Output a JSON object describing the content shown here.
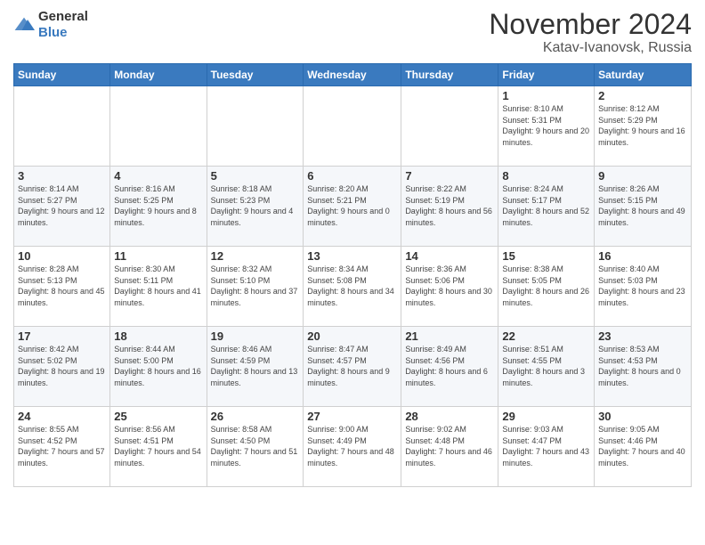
{
  "header": {
    "logo_general": "General",
    "logo_blue": "Blue",
    "month_title": "November 2024",
    "location": "Katav-Ivanovsk, Russia"
  },
  "weekdays": [
    "Sunday",
    "Monday",
    "Tuesday",
    "Wednesday",
    "Thursday",
    "Friday",
    "Saturday"
  ],
  "weeks": [
    [
      {
        "day": "",
        "info": ""
      },
      {
        "day": "",
        "info": ""
      },
      {
        "day": "",
        "info": ""
      },
      {
        "day": "",
        "info": ""
      },
      {
        "day": "",
        "info": ""
      },
      {
        "day": "1",
        "info": "Sunrise: 8:10 AM\nSunset: 5:31 PM\nDaylight: 9 hours and 20 minutes."
      },
      {
        "day": "2",
        "info": "Sunrise: 8:12 AM\nSunset: 5:29 PM\nDaylight: 9 hours and 16 minutes."
      }
    ],
    [
      {
        "day": "3",
        "info": "Sunrise: 8:14 AM\nSunset: 5:27 PM\nDaylight: 9 hours and 12 minutes."
      },
      {
        "day": "4",
        "info": "Sunrise: 8:16 AM\nSunset: 5:25 PM\nDaylight: 9 hours and 8 minutes."
      },
      {
        "day": "5",
        "info": "Sunrise: 8:18 AM\nSunset: 5:23 PM\nDaylight: 9 hours and 4 minutes."
      },
      {
        "day": "6",
        "info": "Sunrise: 8:20 AM\nSunset: 5:21 PM\nDaylight: 9 hours and 0 minutes."
      },
      {
        "day": "7",
        "info": "Sunrise: 8:22 AM\nSunset: 5:19 PM\nDaylight: 8 hours and 56 minutes."
      },
      {
        "day": "8",
        "info": "Sunrise: 8:24 AM\nSunset: 5:17 PM\nDaylight: 8 hours and 52 minutes."
      },
      {
        "day": "9",
        "info": "Sunrise: 8:26 AM\nSunset: 5:15 PM\nDaylight: 8 hours and 49 minutes."
      }
    ],
    [
      {
        "day": "10",
        "info": "Sunrise: 8:28 AM\nSunset: 5:13 PM\nDaylight: 8 hours and 45 minutes."
      },
      {
        "day": "11",
        "info": "Sunrise: 8:30 AM\nSunset: 5:11 PM\nDaylight: 8 hours and 41 minutes."
      },
      {
        "day": "12",
        "info": "Sunrise: 8:32 AM\nSunset: 5:10 PM\nDaylight: 8 hours and 37 minutes."
      },
      {
        "day": "13",
        "info": "Sunrise: 8:34 AM\nSunset: 5:08 PM\nDaylight: 8 hours and 34 minutes."
      },
      {
        "day": "14",
        "info": "Sunrise: 8:36 AM\nSunset: 5:06 PM\nDaylight: 8 hours and 30 minutes."
      },
      {
        "day": "15",
        "info": "Sunrise: 8:38 AM\nSunset: 5:05 PM\nDaylight: 8 hours and 26 minutes."
      },
      {
        "day": "16",
        "info": "Sunrise: 8:40 AM\nSunset: 5:03 PM\nDaylight: 8 hours and 23 minutes."
      }
    ],
    [
      {
        "day": "17",
        "info": "Sunrise: 8:42 AM\nSunset: 5:02 PM\nDaylight: 8 hours and 19 minutes."
      },
      {
        "day": "18",
        "info": "Sunrise: 8:44 AM\nSunset: 5:00 PM\nDaylight: 8 hours and 16 minutes."
      },
      {
        "day": "19",
        "info": "Sunrise: 8:46 AM\nSunset: 4:59 PM\nDaylight: 8 hours and 13 minutes."
      },
      {
        "day": "20",
        "info": "Sunrise: 8:47 AM\nSunset: 4:57 PM\nDaylight: 8 hours and 9 minutes."
      },
      {
        "day": "21",
        "info": "Sunrise: 8:49 AM\nSunset: 4:56 PM\nDaylight: 8 hours and 6 minutes."
      },
      {
        "day": "22",
        "info": "Sunrise: 8:51 AM\nSunset: 4:55 PM\nDaylight: 8 hours and 3 minutes."
      },
      {
        "day": "23",
        "info": "Sunrise: 8:53 AM\nSunset: 4:53 PM\nDaylight: 8 hours and 0 minutes."
      }
    ],
    [
      {
        "day": "24",
        "info": "Sunrise: 8:55 AM\nSunset: 4:52 PM\nDaylight: 7 hours and 57 minutes."
      },
      {
        "day": "25",
        "info": "Sunrise: 8:56 AM\nSunset: 4:51 PM\nDaylight: 7 hours and 54 minutes."
      },
      {
        "day": "26",
        "info": "Sunrise: 8:58 AM\nSunset: 4:50 PM\nDaylight: 7 hours and 51 minutes."
      },
      {
        "day": "27",
        "info": "Sunrise: 9:00 AM\nSunset: 4:49 PM\nDaylight: 7 hours and 48 minutes."
      },
      {
        "day": "28",
        "info": "Sunrise: 9:02 AM\nSunset: 4:48 PM\nDaylight: 7 hours and 46 minutes."
      },
      {
        "day": "29",
        "info": "Sunrise: 9:03 AM\nSunset: 4:47 PM\nDaylight: 7 hours and 43 minutes."
      },
      {
        "day": "30",
        "info": "Sunrise: 9:05 AM\nSunset: 4:46 PM\nDaylight: 7 hours and 40 minutes."
      }
    ]
  ]
}
